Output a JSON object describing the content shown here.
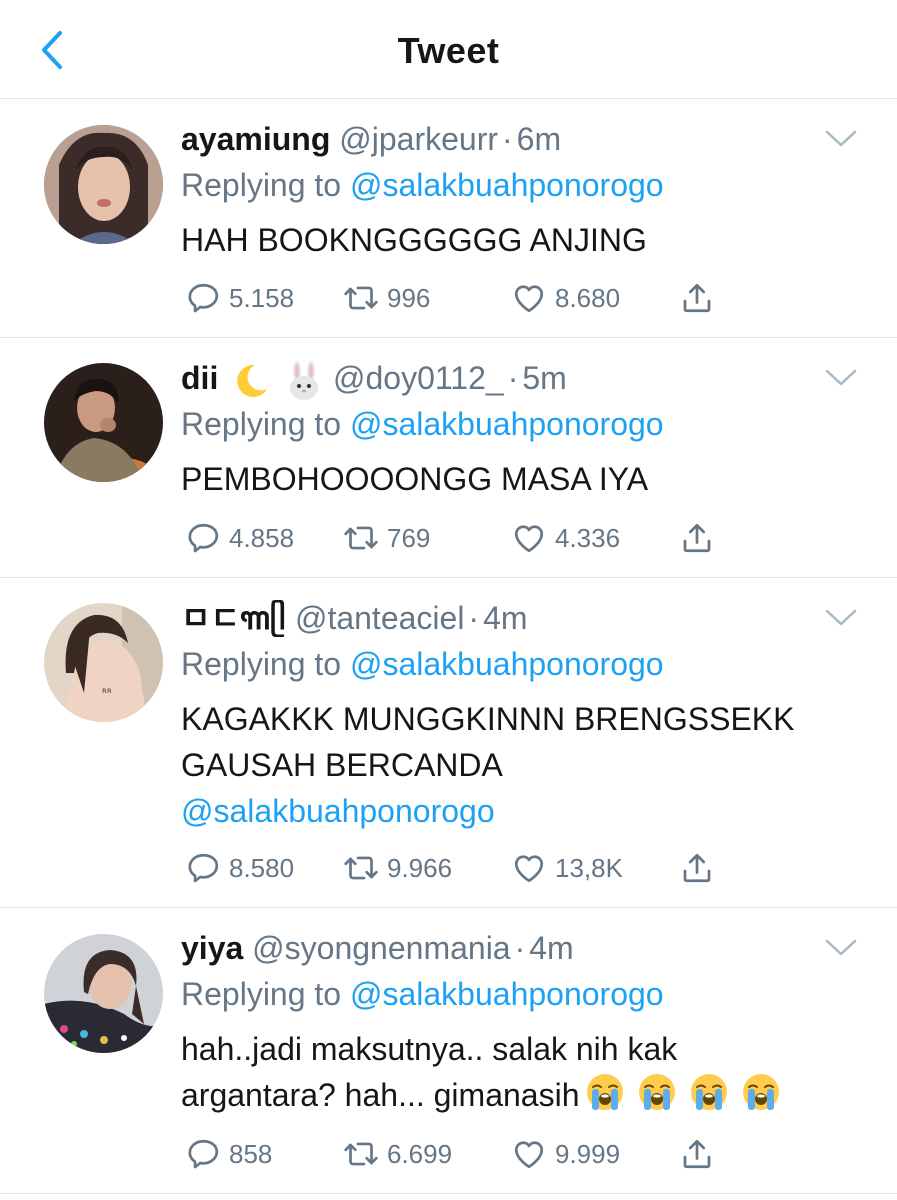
{
  "header": {
    "title": "Tweet"
  },
  "colors": {
    "link": "#1da1f2",
    "muted": "#657786",
    "text": "#14171a",
    "divider": "#e1e8ed"
  },
  "icons": {
    "back": "chevron-left-icon",
    "menu": "chevron-down-icon",
    "reply": "reply-bubble-icon",
    "retweet": "retweet-icon",
    "like": "heart-icon",
    "share": "share-icon"
  },
  "tweets": [
    {
      "name": "ayamiung",
      "handle": "@jparkeurr",
      "dot": "·",
      "time": "6m",
      "replying_prefix": "Replying to",
      "replying_to": "@salakbuahponorogo",
      "text": "HAH BOOKNGGGGGG ANJING",
      "replies": "5.158",
      "retweets": "996",
      "likes": "8.680"
    },
    {
      "name": "dii",
      "name_emojis": [
        "crescent-moon-emoji",
        "rabbit-face-emoji"
      ],
      "handle": "@doy0112_",
      "dot": "·",
      "time": "5m",
      "replying_prefix": "Replying to",
      "replying_to": "@salakbuahponorogo",
      "text": "PEMBOHOOOONGG MASA IYA",
      "replies": "4.858",
      "retweets": "769",
      "likes": "4.336"
    },
    {
      "name": "ㅁㄷ꧑ᥫ",
      "handle": "@tanteaciel",
      "dot": "·",
      "time": "4m",
      "replying_prefix": "Replying to",
      "replying_to": "@salakbuahponorogo",
      "text_line1": "KAGAKKK MUNGGKINNN BRENGSSEKK",
      "text_line2": "GAUSAH BERCANDA",
      "text_mention": "@salakbuahponorogo",
      "replies": "8.580",
      "retweets": "9.966",
      "likes": "13,8K"
    },
    {
      "name": "yiya",
      "handle": "@syongnenmania",
      "dot": "·",
      "time": "4m",
      "replying_prefix": "Replying to",
      "replying_to": "@salakbuahponorogo",
      "text_line1": "hah..jadi maksutnya.. salak nih kak",
      "text_line2": "argantara? hah... gimanasih",
      "text_emojis": [
        "loudly-crying-face-emoji",
        "loudly-crying-face-emoji",
        "loudly-crying-face-emoji",
        "loudly-crying-face-emoji"
      ],
      "replies": "858",
      "retweets": "6.699",
      "likes": "9.999"
    }
  ]
}
